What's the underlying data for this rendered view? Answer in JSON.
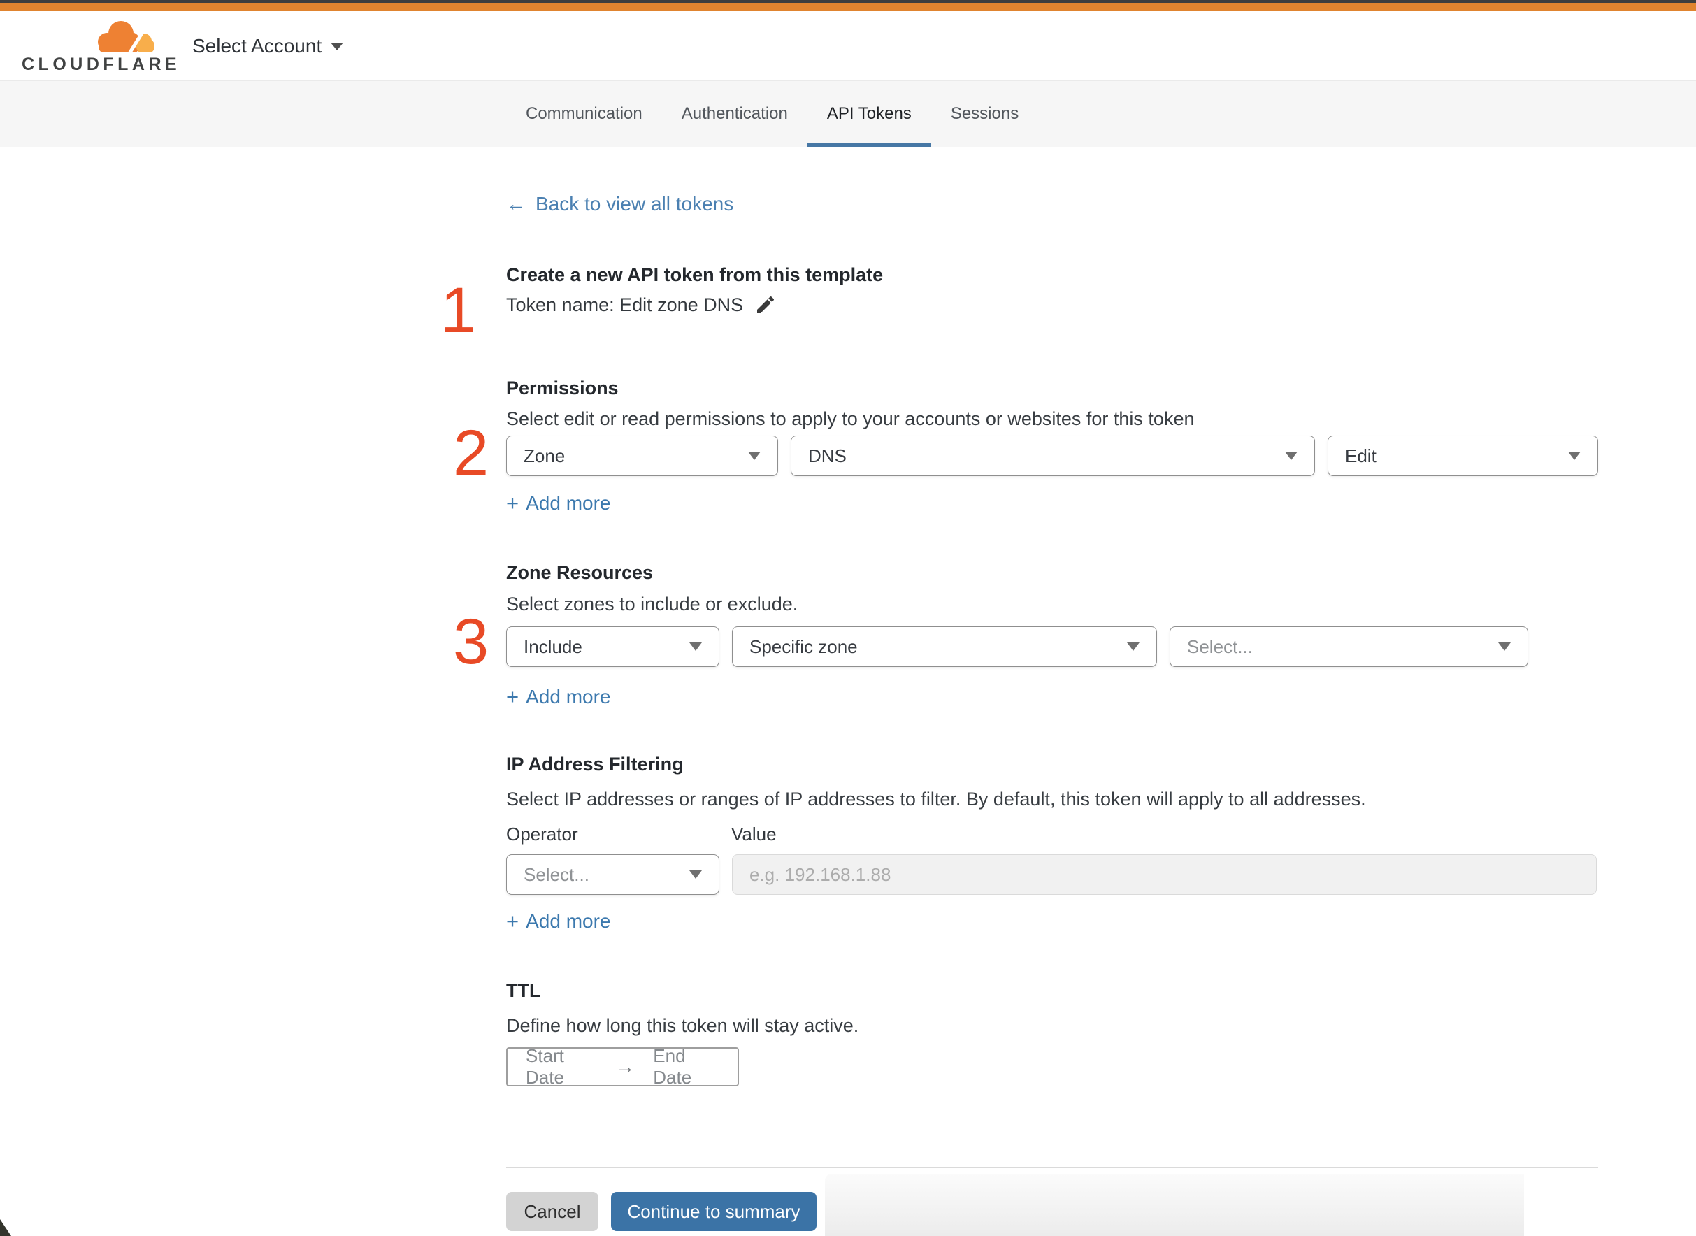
{
  "brand": {
    "logo_text": "CLOUDFLARE",
    "account_selector": "Select Account"
  },
  "tabs": [
    {
      "label": "Communication",
      "active": false
    },
    {
      "label": "Authentication",
      "active": false
    },
    {
      "label": "API Tokens",
      "active": true
    },
    {
      "label": "Sessions",
      "active": false
    }
  ],
  "icons": {
    "plus": "+",
    "back_arrow": "←",
    "range_arrow": "→"
  },
  "back_link": "Back to view all tokens",
  "page": {
    "title": "Create a new API token from this template",
    "token_name_label": "Token name: Edit zone DNS"
  },
  "annotations": [
    "1",
    "2",
    "3"
  ],
  "sections": {
    "permissions": {
      "heading": "Permissions",
      "description": "Select edit or read permissions to apply to your accounts or websites for this token",
      "scope_value": "Zone",
      "category_value": "DNS",
      "level_value": "Edit",
      "add_more_label": "Add more"
    },
    "zone_resources": {
      "heading": "Zone Resources",
      "description": "Select zones to include or exclude.",
      "mode_value": "Include",
      "scope_value": "Specific zone",
      "zone_value": "Select...",
      "add_more_label": "Add more"
    },
    "ip_filtering": {
      "heading": "IP Address Filtering",
      "description": "Select IP addresses or ranges of IP addresses to filter. By default, this token will apply to all addresses.",
      "operator_label": "Operator",
      "value_label": "Value",
      "operator_value": "Select...",
      "value_placeholder": "e.g. 192.168.1.88",
      "add_more_label": "Add more"
    },
    "ttl": {
      "heading": "TTL",
      "description": "Define how long this token will stay active.",
      "start_date": "Start Date",
      "end_date": "End Date"
    }
  },
  "footer": {
    "cancel_label": "Cancel",
    "continue_label": "Continue to summary"
  },
  "colors": {
    "top_bar_orange": "#E0842F",
    "top_bar_dark": "#3D3E3E",
    "link_blue": "#4B80B1",
    "tab_underline": "#4677A5",
    "annotation_red": "#E84A26",
    "button_blue": "#3B73A6",
    "logo_orange": "#EE8133",
    "logo_light_orange": "#F8AE4B"
  }
}
